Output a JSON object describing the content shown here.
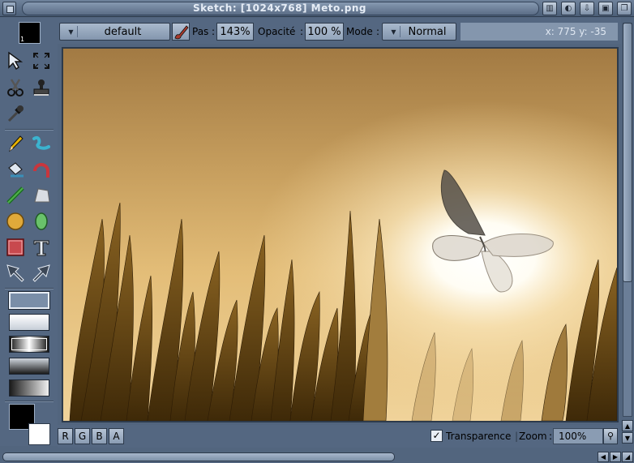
{
  "window": {
    "title": "Sketch: [1024x768] Meto.png"
  },
  "toolbox": {
    "current_color_index": "1",
    "tools": [
      {
        "id": "select",
        "icon": "arrow-pointer-icon"
      },
      {
        "id": "zoom-fit",
        "icon": "expand-corners-icon"
      },
      {
        "id": "cut",
        "icon": "scissors-icon"
      },
      {
        "id": "stamp",
        "icon": "stamp-icon"
      },
      {
        "id": "eyedropper",
        "icon": "eyedropper-icon"
      },
      {
        "id": "pencil",
        "icon": "pencil-icon"
      },
      {
        "id": "freehand",
        "icon": "curve-icon"
      },
      {
        "id": "fill",
        "icon": "bucket-icon"
      },
      {
        "id": "arc",
        "icon": "arc-icon"
      },
      {
        "id": "line",
        "icon": "line-icon"
      },
      {
        "id": "polygon",
        "icon": "polygon-icon"
      },
      {
        "id": "circle",
        "icon": "circle-icon"
      },
      {
        "id": "ellipse",
        "icon": "ellipse-icon"
      },
      {
        "id": "rectangle",
        "icon": "rectangle-icon"
      },
      {
        "id": "text",
        "icon": "text-icon"
      },
      {
        "id": "move-left",
        "icon": "arrow-nw-icon"
      },
      {
        "id": "move-right",
        "icon": "arrow-ne-icon"
      }
    ]
  },
  "options": {
    "brush_preset": "default",
    "pas_label": "Pas",
    "pas_value": "143%",
    "opacity_label": "Opacité",
    "opacity_value": "100 %",
    "mode_label": "Mode",
    "mode_value": "Normal",
    "coords": "x: 775 y: -35",
    "label_separator": ":"
  },
  "bottombar": {
    "channels": [
      "R",
      "G",
      "B",
      "A"
    ],
    "transparency_label": "Transparence",
    "transparency_checked": true,
    "zoom_label": "Zoom",
    "zoom_value": "100%"
  },
  "colors": {
    "ui_bg": "#546781",
    "foreground": "#000000",
    "background": "#ffffff"
  }
}
